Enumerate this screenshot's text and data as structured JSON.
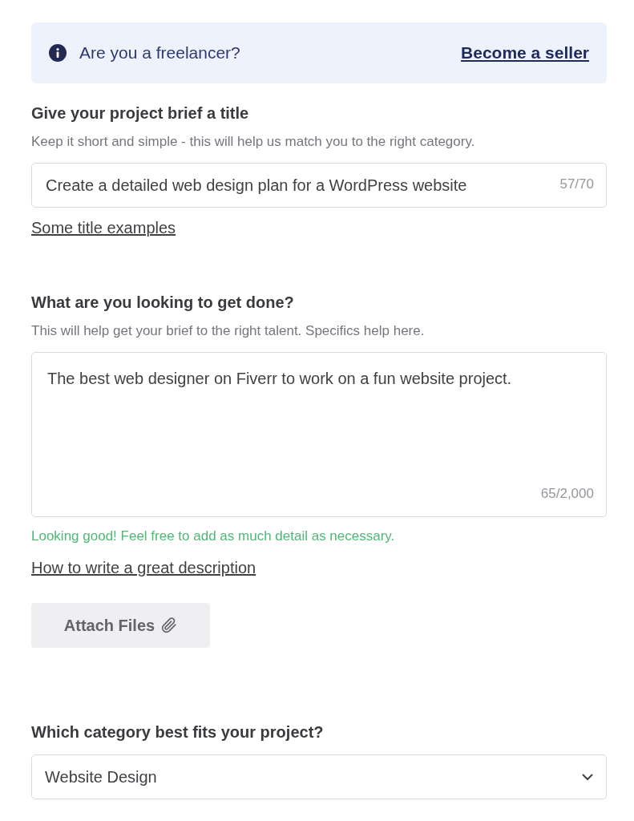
{
  "banner": {
    "text": "Are you a freelancer?",
    "link": "Become a seller"
  },
  "title_section": {
    "label": "Give your project brief a title",
    "hint": "Keep it short and simple - this will help us match you to the right category.",
    "input": {
      "value": "Create a detailed web design plan for a WordPress website",
      "counter": "57/70"
    },
    "link": "Some title examples"
  },
  "description_section": {
    "label": "What are you looking to get done?",
    "hint": "This will help get your brief to the right talent. Specifics help here.",
    "textarea": {
      "value": "The best web designer on Fiverr to work on a fun website project.",
      "counter": "65/2,000"
    },
    "feedback": {
      "kind": "success",
      "text": "Looking good! Feel free to add as much detail as necessary."
    },
    "link": "How to write a great description"
  },
  "attach_button": {
    "label": "Attach Files"
  },
  "category_section": {
    "label": "Which category best fits your project?",
    "select": {
      "value": "Website Design"
    }
  }
}
